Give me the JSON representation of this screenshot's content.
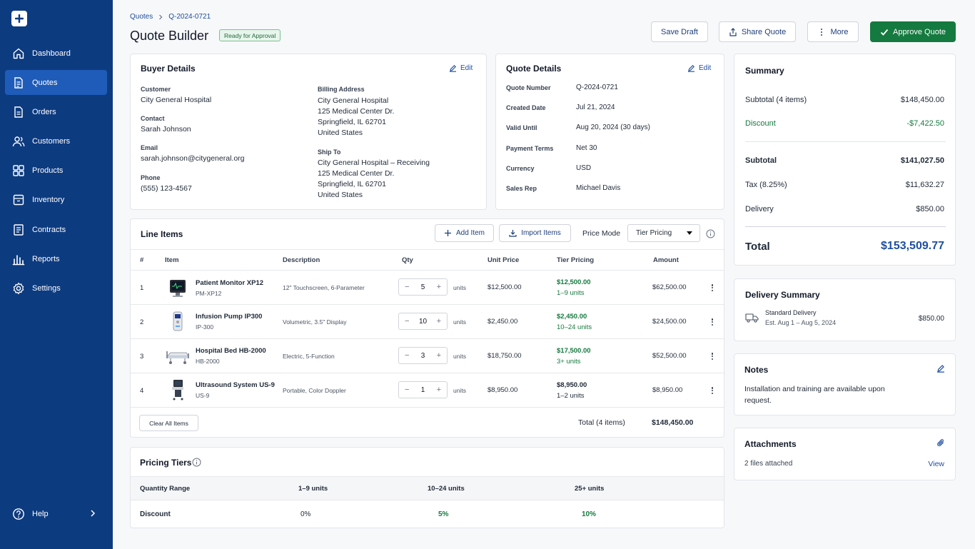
{
  "sidebar": {
    "items": [
      {
        "label": "Dashboard"
      },
      {
        "label": "Quotes"
      },
      {
        "label": "Orders"
      },
      {
        "label": "Customers"
      },
      {
        "label": "Products"
      },
      {
        "label": "Inventory"
      },
      {
        "label": "Contracts"
      },
      {
        "label": "Reports"
      },
      {
        "label": "Settings"
      }
    ],
    "active": "Quotes",
    "help": "Help"
  },
  "header": {
    "breadcrumb": [
      "Quotes",
      "Q-2024-0721"
    ],
    "title": "Quote Builder",
    "status": "Ready for Approval",
    "buttons": {
      "save_draft": "Save Draft",
      "share": "Share Quote",
      "more": "More",
      "approve": "Approve Quote"
    }
  },
  "buyer": {
    "title": "Buyer Details",
    "edit": "Edit",
    "customer_label": "Customer",
    "customer": "City General Hospital",
    "contact_label": "Contact",
    "contact": "Sarah Johnson",
    "email_label": "Email",
    "email": "sarah.johnson@citygeneral.org",
    "phone_label": "Phone",
    "phone": "(555) 123-4567",
    "billing_label": "Billing Address",
    "billing": [
      "City General Hospital",
      "125 Medical Center Dr.",
      "Springfield, IL 62701",
      "United States"
    ],
    "ship_label": "Ship To",
    "ship": [
      "City General Hospital – Receiving",
      "125 Medical Center Dr.",
      "Springfield, IL 62701",
      "United States"
    ]
  },
  "quote": {
    "title": "Quote Details",
    "edit": "Edit",
    "fields": [
      {
        "label": "Quote Number",
        "value": "Q-2024-0721"
      },
      {
        "label": "Created Date",
        "value": "Jul 21, 2024"
      },
      {
        "label": "Valid Until",
        "value": "Aug 20, 2024 (30 days)"
      },
      {
        "label": "Payment Terms",
        "value": "Net 30"
      },
      {
        "label": "Currency",
        "value": "USD"
      },
      {
        "label": "Sales Rep",
        "value": "Michael Davis"
      }
    ]
  },
  "line_items": {
    "title": "Line Items",
    "add": "Add Item",
    "import": "Import Items",
    "price_mode_label": "Price Mode",
    "price_mode": "Tier Pricing",
    "columns": [
      "#",
      "Item",
      "Description",
      "Qty",
      "Unit Price",
      "Tier Pricing",
      "Amount"
    ],
    "unit_label": "units",
    "rows": [
      {
        "num": "1",
        "name": "Patient Monitor XP12",
        "sku": "PM-XP12",
        "desc": "12\" Touchscreen, 6-Parameter",
        "qty": "5",
        "unit_price": "$12,500.00",
        "tier_price": "$12,500.00",
        "tier_range": "1–9 units",
        "tier_green": true,
        "amount": "$62,500.00"
      },
      {
        "num": "2",
        "name": "Infusion Pump IP300",
        "sku": "IP-300",
        "desc": "Volumetric, 3.5\" Display",
        "qty": "10",
        "unit_price": "$2,450.00",
        "tier_price": "$2,450.00",
        "tier_range": "10–24 units",
        "tier_green": true,
        "amount": "$24,500.00"
      },
      {
        "num": "3",
        "name": "Hospital Bed HB-2000",
        "sku": "HB-2000",
        "desc": "Electric, 5-Function",
        "qty": "3",
        "unit_price": "$18,750.00",
        "tier_price": "$17,500.00",
        "tier_range": "3+ units",
        "tier_green": true,
        "amount": "$52,500.00"
      },
      {
        "num": "4",
        "name": "Ultrasound System US-9",
        "sku": "US-9",
        "desc": "Portable, Color Doppler",
        "qty": "1",
        "unit_price": "$8,950.00",
        "tier_price": "$8,950.00",
        "tier_range": "1–2 units",
        "tier_green": false,
        "amount": "$8,950.00"
      }
    ],
    "clear": "Clear All Items",
    "total_label": "Total (4 items)",
    "total": "$148,450.00"
  },
  "tiers": {
    "title": "Pricing Tiers",
    "range_label": "Quantity Range",
    "discount_label": "Discount",
    "ranges": [
      "1–9 units",
      "10–24 units",
      "25+ units"
    ],
    "discounts": [
      "0%",
      "5%",
      "10%"
    ]
  },
  "summary": {
    "title": "Summary",
    "subtotal_items_label": "Subtotal (4 items)",
    "subtotal_items": "$148,450.00",
    "discount_label": "Discount",
    "discount": "-$7,422.50",
    "subtotal_label": "Subtotal",
    "subtotal": "$141,027.50",
    "tax_label": "Tax (8.25%)",
    "tax": "$11,632.27",
    "delivery_label": "Delivery",
    "delivery": "$850.00",
    "total_label": "Total",
    "total": "$153,509.77"
  },
  "delivery": {
    "title": "Delivery Summary",
    "method": "Standard Delivery",
    "est": "Est. Aug 1 – Aug 5, 2024",
    "cost": "$850.00"
  },
  "notes": {
    "title": "Notes",
    "text": "Installation and training are available upon request."
  },
  "attachments": {
    "title": "Attachments",
    "count": "2 files attached",
    "view": "View"
  },
  "colors": {
    "sidebar": "#0d3b80",
    "accent": "#1f4fa0",
    "green": "#157a3f"
  }
}
